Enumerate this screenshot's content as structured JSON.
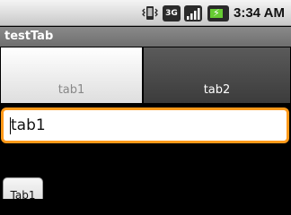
{
  "status_bar": {
    "time": "3:34",
    "ampm": "AM",
    "network_label": "3G",
    "icons": [
      "vibrate-icon",
      "3g-icon",
      "signal-icon",
      "battery-icon"
    ],
    "battery_color": "#66cc33"
  },
  "app": {
    "title": "testTab"
  },
  "tabs": [
    {
      "label": "tab1",
      "selected": false
    },
    {
      "label": "tab2",
      "selected": true
    }
  ],
  "content": {
    "text_field_value": "tab1",
    "button_label": "Tab1",
    "focus_color": "#ff9a1a"
  }
}
